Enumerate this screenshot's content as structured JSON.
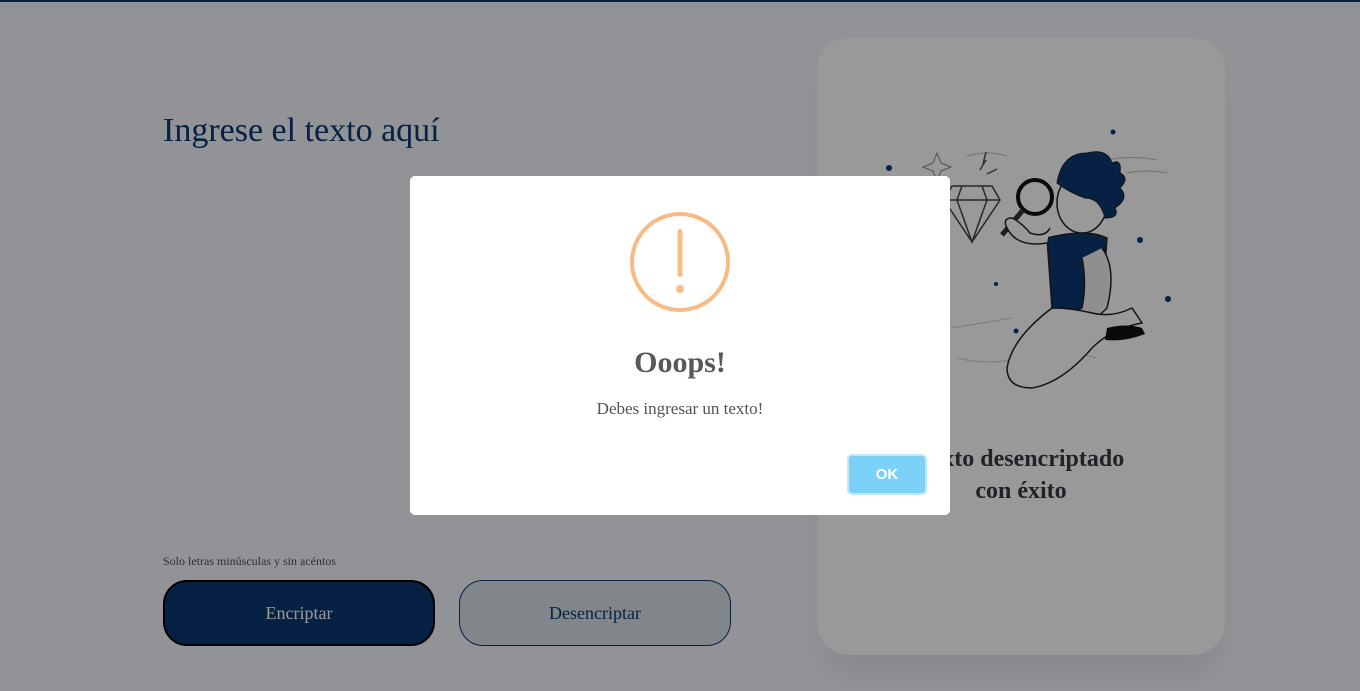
{
  "main": {
    "heading": "Ingrese el texto aquí",
    "hint": "Solo letras minúsculas y sin acéntos",
    "encrypt_label": "Encriptar",
    "decrypt_label": "Desencriptar"
  },
  "result_card": {
    "illustration_icon": "person-with-magnifying-glass-illustration",
    "message_line1": "Texto desencriptado",
    "message_line2": "con éxito"
  },
  "modal": {
    "icon": "warning-icon",
    "title": "Ooops!",
    "text": "Debes ingresar un texto!",
    "ok_label": "OK"
  },
  "colors": {
    "primary": "#0a3871",
    "warning": "#f8bb86",
    "ok_button": "#7cd1f9"
  }
}
